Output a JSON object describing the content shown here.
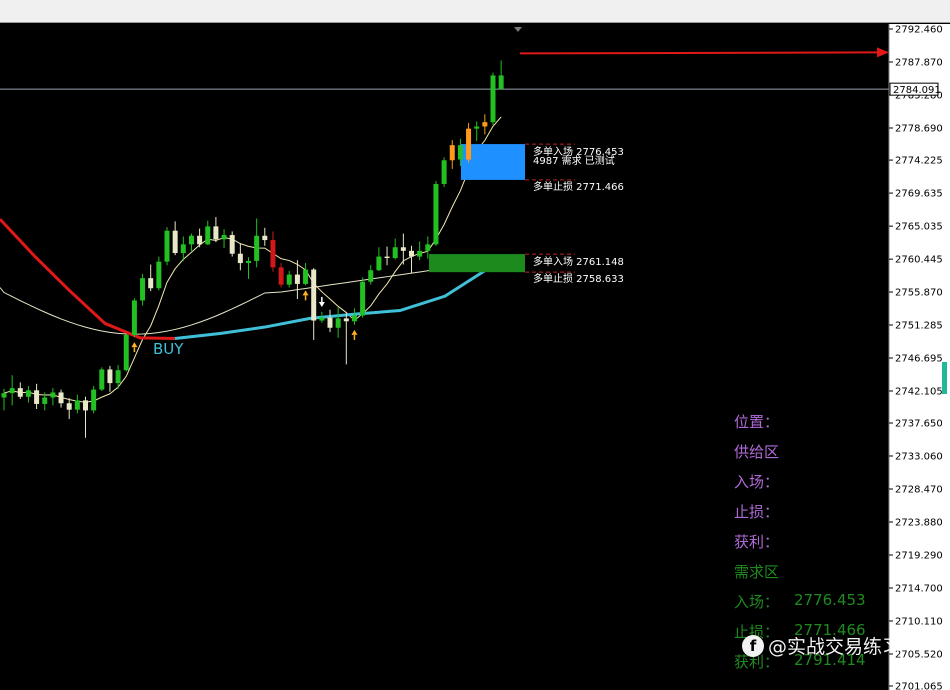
{
  "chart_data": {
    "type": "candlestick",
    "y_ticks": [
      "2792.460",
      "2787.870",
      "2783.280",
      "2778.690",
      "2774.225",
      "2769.635",
      "2765.035",
      "2760.445",
      "2755.870",
      "2751.285",
      "2746.695",
      "2742.105",
      "2737.650",
      "2733.060",
      "2728.470",
      "2723.880",
      "2719.290",
      "2714.700",
      "2710.110",
      "2705.520",
      "2701.065"
    ],
    "current_price": "2784.091",
    "ylim": [
      2701.065,
      2792.46
    ],
    "candles": [
      [
        2741.2,
        2742.4,
        2739.4,
        2741.8
      ],
      [
        2741.8,
        2744.3,
        2740.1,
        2742.5
      ],
      [
        2742.5,
        2743.3,
        2741.0,
        2741.3
      ],
      [
        2741.3,
        2742.8,
        2740.5,
        2742.2
      ],
      [
        2742.2,
        2743.1,
        2739.6,
        2740.3
      ],
      [
        2740.3,
        2741.9,
        2739.4,
        2741.2
      ],
      [
        2741.2,
        2742.5,
        2740.1,
        2741.9
      ],
      [
        2741.9,
        2742.3,
        2739.8,
        2740.4
      ],
      [
        2740.4,
        2741.1,
        2738.2,
        2739.5
      ],
      [
        2739.5,
        2741.6,
        2739.0,
        2740.8
      ],
      [
        2740.8,
        2741.3,
        2735.6,
        2739.4
      ],
      [
        2739.4,
        2742.8,
        2739.0,
        2742.3
      ],
      [
        2742.3,
        2745.4,
        2742.1,
        2745.1
      ],
      [
        2745.1,
        2745.6,
        2742.0,
        2743.2
      ],
      [
        2743.2,
        2745.7,
        2742.4,
        2745.0
      ],
      [
        2745.0,
        2750.0,
        2744.8,
        2749.9
      ],
      [
        2749.9,
        2755.0,
        2749.6,
        2754.7
      ],
      [
        2754.7,
        2758.4,
        2754.0,
        2757.8
      ],
      [
        2757.8,
        2759.7,
        2756.0,
        2756.4
      ],
      [
        2756.4,
        2760.8,
        2756.1,
        2760.1
      ],
      [
        2760.1,
        2764.9,
        2759.6,
        2764.4
      ],
      [
        2764.4,
        2765.7,
        2761.0,
        2761.3
      ],
      [
        2761.3,
        2763.6,
        2760.2,
        2762.5
      ],
      [
        2762.5,
        2764.0,
        2761.6,
        2763.7
      ],
      [
        2763.7,
        2764.7,
        2762.1,
        2762.5
      ],
      [
        2762.5,
        2765.8,
        2762.4,
        2765.0
      ],
      [
        2765.0,
        2766.3,
        2762.8,
        2763.2
      ],
      [
        2763.2,
        2764.6,
        2762.0,
        2763.8
      ],
      [
        2763.8,
        2764.3,
        2760.8,
        2761.2
      ],
      [
        2761.2,
        2762.6,
        2758.9,
        2759.9
      ],
      [
        2759.9,
        2760.7,
        2757.7,
        2760.2
      ],
      [
        2760.2,
        2766.1,
        2759.3,
        2763.7
      ],
      [
        2763.7,
        2764.8,
        2762.3,
        2763.1
      ],
      [
        2763.1,
        2764.3,
        2758.7,
        2759.3
      ],
      [
        2759.3,
        2759.9,
        2756.5,
        2756.9
      ],
      [
        2756.9,
        2758.8,
        2756.5,
        2758.3
      ],
      [
        2758.3,
        2760.3,
        2754.9,
        2757.0
      ],
      [
        2757.0,
        2759.9,
        2756.8,
        2759.0
      ],
      [
        2759.0,
        2759.2,
        2749.2,
        2751.9
      ],
      [
        2751.9,
        2753.1,
        2751.6,
        2752.3
      ],
      [
        2752.3,
        2753.4,
        2750.3,
        2750.9
      ],
      [
        2750.9,
        2753.7,
        2749.5,
        2752.2
      ],
      [
        2752.2,
        2752.9,
        2745.8,
        2751.8
      ],
      [
        2751.8,
        2753.6,
        2751.3,
        2752.6
      ],
      [
        2752.6,
        2757.9,
        2752.3,
        2757.3
      ],
      [
        2757.3,
        2759.6,
        2756.9,
        2758.9
      ],
      [
        2758.9,
        2762.1,
        2758.8,
        2760.8
      ],
      [
        2760.8,
        2762.2,
        2759.6,
        2760.6
      ],
      [
        2760.6,
        2763.3,
        2760.4,
        2762.1
      ],
      [
        2762.1,
        2764.0,
        2759.7,
        2761.6
      ],
      [
        2761.6,
        2762.3,
        2758.5,
        2760.8
      ],
      [
        2760.8,
        2762.9,
        2760.3,
        2761.6
      ],
      [
        2761.6,
        2763.6,
        2760.5,
        2762.5
      ],
      [
        2762.5,
        2771.3,
        2762.3,
        2770.9
      ],
      [
        2770.9,
        2774.6,
        2770.5,
        2774.2
      ],
      [
        2774.2,
        2777.0,
        2773.0,
        2776.3
      ],
      [
        2776.3,
        2777.2,
        2773.4,
        2774.3
      ],
      [
        2774.3,
        2779.4,
        2773.9,
        2778.6
      ],
      [
        2778.6,
        2779.6,
        2776.9,
        2778.9
      ],
      [
        2778.9,
        2780.6,
        2777.8,
        2779.5
      ],
      [
        2779.5,
        2786.4,
        2779.1,
        2786.0
      ],
      [
        2786.0,
        2788.1,
        2784.3,
        2784.1
      ]
    ],
    "candle_colors": [
      "g",
      "g",
      "w",
      "g",
      "w",
      "g",
      "g",
      "w",
      "w",
      "g",
      "w",
      "g",
      "g",
      "w",
      "g",
      "g",
      "g",
      "g",
      "w",
      "g",
      "g",
      "w",
      "g",
      "g",
      "w",
      "g",
      "w",
      "g",
      "w",
      "w",
      "g",
      "g",
      "w",
      "r",
      "r",
      "g",
      "w",
      "g",
      "w",
      "g",
      "w",
      "g",
      "w",
      "g",
      "g",
      "g",
      "g",
      "w",
      "g",
      "w",
      "w",
      "g",
      "g",
      "g",
      "g",
      "o",
      "g",
      "o",
      "g",
      "o",
      "g",
      "g"
    ],
    "ma_red": [
      2766.0,
      2760.8,
      2756.0,
      2751.5,
      2749.5,
      2749.4
    ],
    "ma_cyan": [
      2749.4,
      2750.1,
      2751.0,
      2752.2,
      2752.8,
      2753.3,
      2755.3,
      2759.3
    ],
    "buy_label": "BUY",
    "arrows_up": [
      16,
      37,
      43
    ],
    "arrow_down": 39,
    "zones": [
      {
        "name": "supply",
        "color": "#1e90ff",
        "top": 2776.453,
        "bottom": 2771.466,
        "label1": "多单入场 2776.453",
        "label2": "4987 需求 已测试",
        "label3": "多单止损 2771.466"
      },
      {
        "name": "demand",
        "color": "#1c8a1c",
        "top": 2761.148,
        "bottom": 2758.633,
        "label1": "多单入场 2761.148",
        "label2": "多单止损 2758.633"
      }
    ],
    "target_price": 2789.2
  },
  "info_panel": {
    "position_label": "位置：",
    "zone_supply": "供给区",
    "entry_label": "入场：",
    "stop_label": "止损：",
    "profit_label": "获利：",
    "zone_demand": "需求区",
    "entry_label2": "入场：",
    "entry_value": "2776.453",
    "stop_label2": "止损：",
    "stop_value": "2771.466",
    "profit_label2": "获利：",
    "profit_value": "2791.414"
  },
  "watermark": "@实战交易练习",
  "colors": {
    "bull": "#22c022",
    "bear": "#d01818",
    "neutral": "#e8e8c8",
    "orange": "#ff9a1a",
    "cyan": "#3fc0d8",
    "ma_red": "#e01818"
  }
}
